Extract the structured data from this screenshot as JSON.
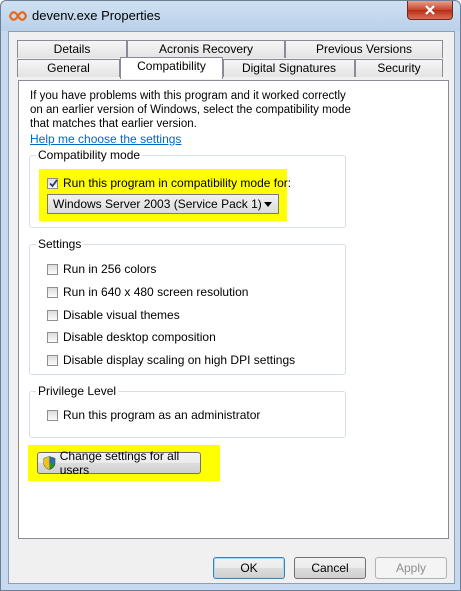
{
  "window": {
    "title": "devenv.exe Properties"
  },
  "tabs": {
    "row1": [
      "Details",
      "Acronis Recovery",
      "Previous Versions"
    ],
    "row2": [
      "General",
      "Compatibility",
      "Digital Signatures",
      "Security"
    ],
    "active": "Compatibility"
  },
  "intro": {
    "text": "If you have problems with this program and it worked correctly on an earlier version of Windows, select the compatibility mode that matches that earlier version.",
    "help_link": "Help me choose the settings"
  },
  "compatibility_mode": {
    "group_label": "Compatibility mode",
    "checkbox_label": "Run this program in compatibility mode for:",
    "checked": true,
    "selected_os": "Windows Server 2003 (Service Pack 1)"
  },
  "settings": {
    "group_label": "Settings",
    "options": [
      "Run in 256 colors",
      "Run in 640 x 480 screen resolution",
      "Disable visual themes",
      "Disable desktop composition",
      "Disable display scaling on high DPI settings"
    ]
  },
  "privilege": {
    "group_label": "Privilege Level",
    "checkbox_label": "Run this program as an administrator"
  },
  "change_all_users_label": "Change settings for all users",
  "buttons": {
    "ok": "OK",
    "cancel": "Cancel",
    "apply": "Apply"
  },
  "colors": {
    "highlight": "#ffff00",
    "link": "#0066cc",
    "close_button": "#c7432a"
  }
}
